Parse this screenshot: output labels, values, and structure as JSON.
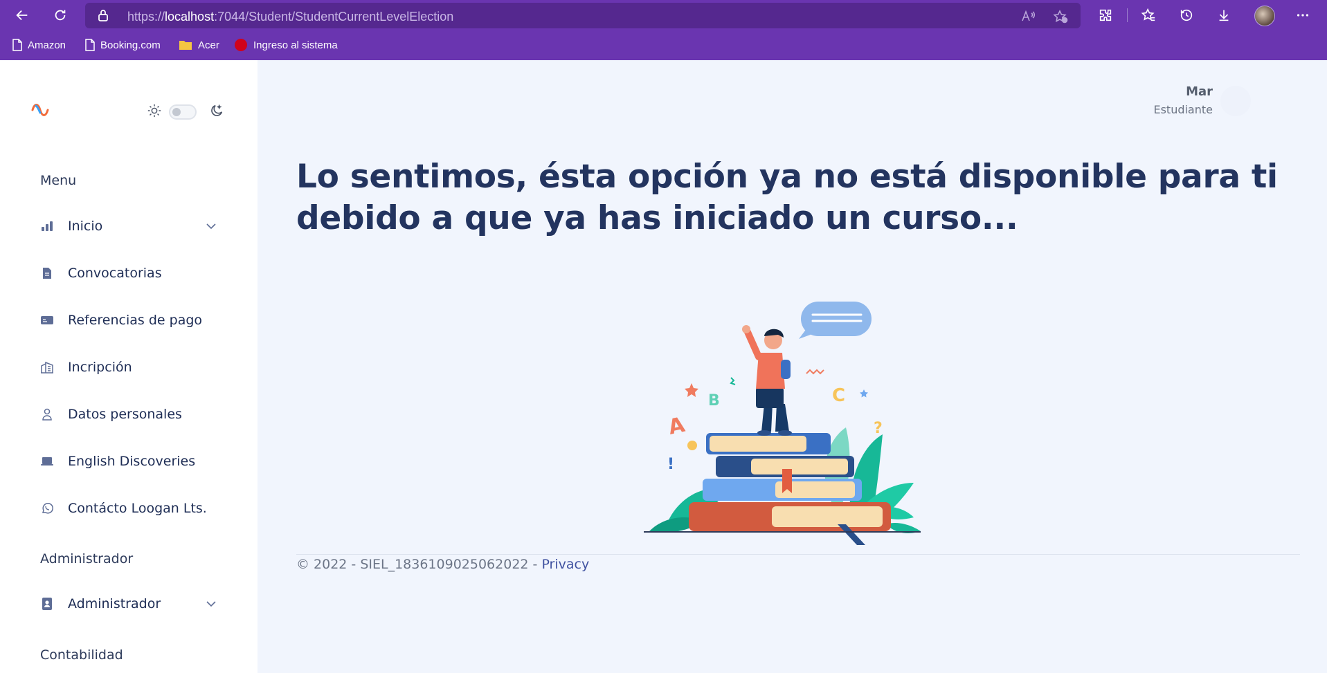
{
  "browser": {
    "url_scheme": "https://",
    "url_host": "localhost",
    "url_rest": ":7044/Student/StudentCurrentLevelElection",
    "bookmarks": [
      {
        "label": "Amazon",
        "icon": "page-icon"
      },
      {
        "label": "Booking.com",
        "icon": "page-icon"
      },
      {
        "label": "Acer",
        "icon": "folder-icon"
      },
      {
        "label": "Ingreso al sistema",
        "icon": "red-circle-icon"
      }
    ]
  },
  "sidebar": {
    "sections": [
      {
        "title": "Menu",
        "items": [
          {
            "label": "Inicio",
            "icon": "bar-chart-icon",
            "expandable": true
          },
          {
            "label": "Convocatorias",
            "icon": "document-icon",
            "expandable": false
          },
          {
            "label": "Referencias de pago",
            "icon": "card-icon",
            "expandable": false
          },
          {
            "label": "Incripción",
            "icon": "building-icon",
            "expandable": false
          },
          {
            "label": "Datos personales",
            "icon": "user-icon",
            "expandable": false
          },
          {
            "label": "English Discoveries",
            "icon": "laptop-icon",
            "expandable": false
          },
          {
            "label": "Contácto Loogan Lts.",
            "icon": "whatsapp-icon",
            "expandable": false
          }
        ]
      },
      {
        "title": "Administrador",
        "items": [
          {
            "label": "Administrador",
            "icon": "id-badge-icon",
            "expandable": true
          }
        ]
      },
      {
        "title": "Contabilidad",
        "items": []
      }
    ]
  },
  "user": {
    "name": "Mar",
    "role": "Estudiante"
  },
  "main": {
    "message": "Lo sentimos, ésta opción ya no está disponible para ti debido a que ya has iniciado un curso..."
  },
  "footer": {
    "text": "© 2022 - SIEL_1836109025062022 - ",
    "privacy_link": "Privacy"
  },
  "colors": {
    "browser_bar": "#6a35b0",
    "url_bar": "#55288f",
    "page_bg": "#f1f5fd",
    "headline": "#23345f",
    "nav_text": "#1e2d55"
  }
}
